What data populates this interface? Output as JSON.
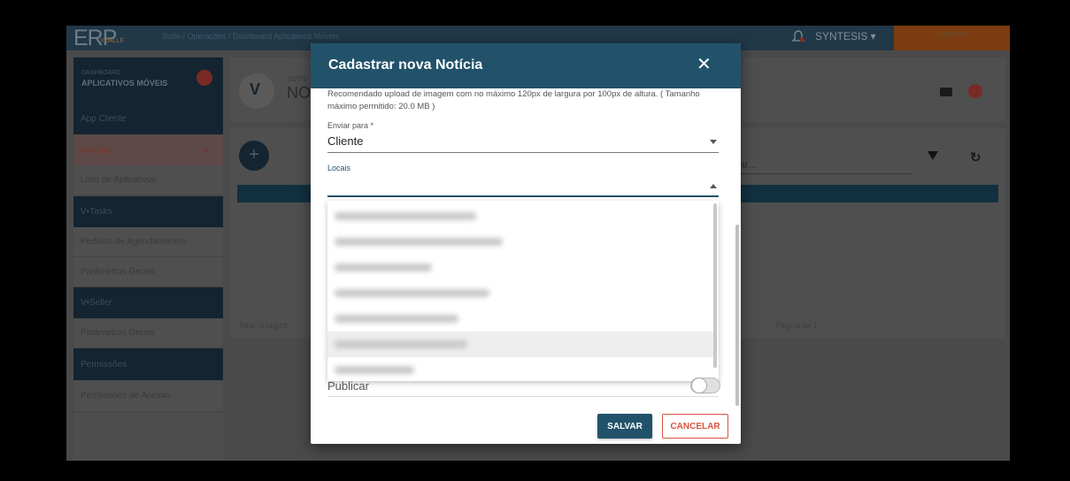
{
  "topbar": {
    "logo": "ERP",
    "logo_sub": "VOALLE",
    "breadcrumb": "Suíte  /  Operações  /  Dashboard  Aplicativos Móveis",
    "user": "SYNTESIS ▾",
    "env_badge": "STAGING"
  },
  "sidebar": {
    "header_small": "DASHBOARD",
    "header_title": "APLICATIVOS MÓVEIS",
    "items": [
      {
        "label": "App Cliente",
        "kind": "dark"
      },
      {
        "label": "Notícias",
        "kind": "active"
      },
      {
        "label": "Lista de Aplicativos",
        "kind": "light"
      },
      {
        "label": "V•Tasks",
        "kind": "dark"
      },
      {
        "label": "Pedidos de Agendamentos",
        "kind": "light"
      },
      {
        "label": "Parâmetros Gerais",
        "kind": "light"
      },
      {
        "label": "V•Seller",
        "kind": "dark"
      },
      {
        "label": "Parâmetros Gerais",
        "kind": "light"
      },
      {
        "label": "Permissões",
        "kind": "dark"
      },
      {
        "label": "Permissões de Acesso",
        "kind": "light"
      }
    ]
  },
  "main": {
    "suite_small": "SUÍTE",
    "page_title": "NO",
    "search_placeholder": "ar...",
    "total": "Total: 0 registr",
    "pagination": "Página   de 1"
  },
  "modal": {
    "title": "Cadastrar nova Notícia",
    "upload_hint": "Recomendado upload de imagem com no máximo 120px de largura por 100px de altura. ( Tamanho máximo permitido: 20.0 MB )",
    "enviar_label": "Enviar para *",
    "enviar_value": "Cliente",
    "locais_label": "Locais",
    "publicar_label": "Publicar",
    "save_label": "SALVAR",
    "cancel_label": "CANCELAR"
  },
  "colors": {
    "modal_header": "#22526a",
    "cancel_accent": "#d9533f"
  }
}
